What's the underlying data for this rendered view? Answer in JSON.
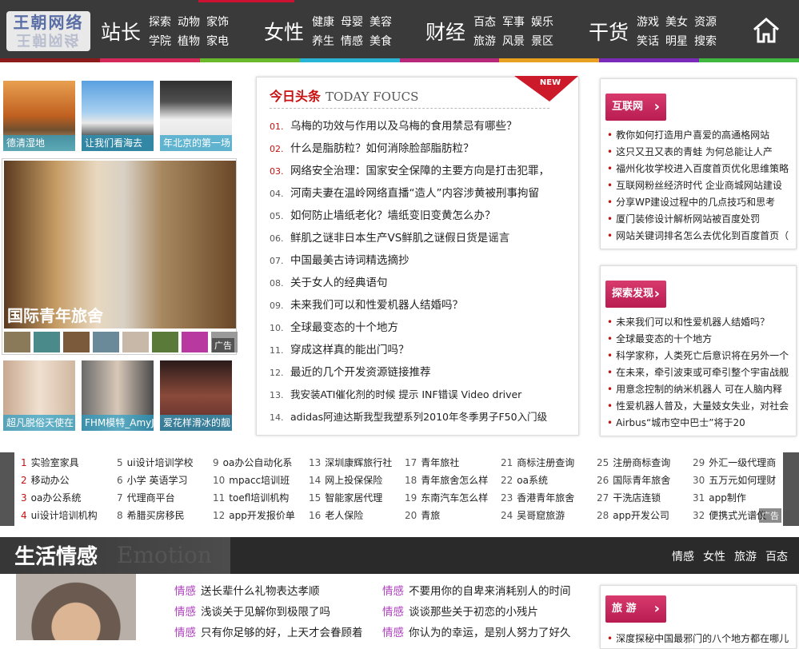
{
  "nav": {
    "logo": "王朝网络",
    "groups": [
      {
        "big": "站长",
        "items": [
          "探索",
          "动物",
          "家饰",
          "学院",
          "植物",
          "家电"
        ]
      },
      {
        "big": "女性",
        "items": [
          "健康",
          "母婴",
          "美容",
          "养生",
          "情感",
          "美食"
        ]
      },
      {
        "big": "财经",
        "items": [
          "百态",
          "军事",
          "娱乐",
          "旅游",
          "风景",
          "景区"
        ]
      },
      {
        "big": "干货",
        "items": [
          "游戏",
          "美女",
          "资源",
          "笑话",
          "明星",
          "搜索"
        ]
      }
    ],
    "home_icon": "home-icon",
    "colors": [
      "#8b1a1a",
      "#d4285a",
      "#6ab82c",
      "#28b4d4",
      "#b8287a",
      "#e8a020",
      "#7a2ab8",
      "#40b840"
    ]
  },
  "left": {
    "thumbs": [
      "德清湿地",
      "让我们看海去",
      "年北京的第一场"
    ],
    "feature_title": "国际青年旅舍",
    "ad": "广告",
    "bottom_thumbs": [
      "超凡脱俗天使在",
      "FHM模特_AmyJac",
      "爱花样滑冰的靓"
    ]
  },
  "center": {
    "title": "今日头条",
    "title_en": "TODAY FOUCS",
    "new": "NEW",
    "items": [
      {
        "n": "01.",
        "t": "乌梅的功效与作用以及乌梅的食用禁忌有哪些？"
      },
      {
        "n": "02.",
        "t": "什么是脂肪粒？如何消除脸部脂肪粒？"
      },
      {
        "n": "03.",
        "t": "网络安全治理：国家安全保障的主要方向是打击犯罪，"
      },
      {
        "n": "04.",
        "t": "河南夫妻在温岭网络直播“造人”内容涉黄被刑事拘留"
      },
      {
        "n": "05.",
        "t": "如何防止墙纸老化？墙纸变旧变黄怎么办？"
      },
      {
        "n": "06.",
        "t": "鲜肌之谜非日本生产VS鲜肌之谜假日货是谣言"
      },
      {
        "n": "07.",
        "t": "中国最美古诗词精选摘抄"
      },
      {
        "n": "08.",
        "t": "关于女人的经典语句"
      },
      {
        "n": "09.",
        "t": "未来我们可以和性爱机器人结婚吗？"
      },
      {
        "n": "10.",
        "t": "全球最变态的十个地方"
      },
      {
        "n": "11.",
        "t": "穿成这样真的能出门吗？"
      },
      {
        "n": "12.",
        "t": "最近的几个开发资源链接推荐"
      },
      {
        "n": "13.",
        "t": "我安装ATI催化剂的时候 提示 INF错误 Video driver"
      },
      {
        "n": "14.",
        "t": "adidas阿迪达斯我型我塑系列2010年冬季男子F50入门级"
      }
    ]
  },
  "right1": {
    "tag": "互联网",
    "items": [
      "教你如何打造用户喜爱的高通格网站",
      "这只又丑又表的青蛙 为何总能让人产",
      "福州化妆学校进入百度首页优化思维策略",
      "互联网粉丝经济时代 企业商城网站建设",
      "分享WP建设过程中的几点技巧和思考",
      "厦门装修设计解析网站被百度处罚",
      "网站关键词排名怎么去优化到百度首页（"
    ]
  },
  "right2": {
    "tag": "探索发现",
    "items": [
      "未来我们可以和性爱机器人结婚吗？",
      "全球最变态的十个地方",
      "科学家称，人类死亡后意识将在另外一个",
      "在未来，牵引波束或可牵引整个宇宙战舰",
      "用意念控制的纳米机器人 可在人脑内释",
      "性爱机器人普及，大量妓女失业，对社会",
      "Airbus“城市空中巴士”将于20"
    ]
  },
  "links": {
    "ad": "广告",
    "items": [
      {
        "n": "1",
        "t": "实验室家具"
      },
      {
        "n": "5",
        "t": "ui设计培训学校"
      },
      {
        "n": "9",
        "t": "oa办公自动化系"
      },
      {
        "n": "13",
        "t": "深圳康辉旅行社"
      },
      {
        "n": "17",
        "t": "青年旅社"
      },
      {
        "n": "21",
        "t": "商标注册查询"
      },
      {
        "n": "25",
        "t": "注册商标查询"
      },
      {
        "n": "29",
        "t": "外汇一级代理商"
      },
      {
        "n": "2",
        "t": "移动办公"
      },
      {
        "n": "6",
        "t": "小学 英语学习"
      },
      {
        "n": "10",
        "t": "mpacc培训班"
      },
      {
        "n": "14",
        "t": "网上投保保险"
      },
      {
        "n": "18",
        "t": "青年旅舍怎么样"
      },
      {
        "n": "22",
        "t": "oa系统"
      },
      {
        "n": "26",
        "t": "国际青年旅舍"
      },
      {
        "n": "30",
        "t": "五万元如何理财"
      },
      {
        "n": "3",
        "t": "oa办公系统"
      },
      {
        "n": "7",
        "t": "代理商平台"
      },
      {
        "n": "11",
        "t": "toefl培训机构"
      },
      {
        "n": "15",
        "t": "智能家居代理"
      },
      {
        "n": "19",
        "t": "东南汽车怎么样"
      },
      {
        "n": "23",
        "t": "香港青年旅舍"
      },
      {
        "n": "27",
        "t": "干洗店连锁"
      },
      {
        "n": "31",
        "t": "app制作"
      },
      {
        "n": "4",
        "t": "ui设计培训机构"
      },
      {
        "n": "8",
        "t": "希腊买房移民"
      },
      {
        "n": "12",
        "t": "app开发报价单"
      },
      {
        "n": "16",
        "t": "老人保险"
      },
      {
        "n": "20",
        "t": "青旅"
      },
      {
        "n": "24",
        "t": "吴哥窟旅游"
      },
      {
        "n": "28",
        "t": "app开发公司"
      },
      {
        "n": "32",
        "t": "便携式光谱仪"
      }
    ]
  },
  "life": {
    "title": "生活情感",
    "title_en": "Emotion",
    "tabs": [
      "情感",
      "女性",
      "旅游",
      "百态"
    ],
    "col1": [
      {
        "c": "情感",
        "t": "送长辈什么礼物表达孝顺"
      },
      {
        "c": "情感",
        "t": "浅谈关于见解你到极限了吗"
      },
      {
        "c": "情感",
        "t": "只有你足够的好，上天才会眷顾着"
      }
    ],
    "col2": [
      {
        "c": "情感",
        "t": "不要用你的自卑来消耗别人的时间"
      },
      {
        "c": "情感",
        "t": "谈谈那些关于初恋的小残片"
      },
      {
        "c": "情感",
        "t": "你认为的幸运，是别人努力了好久"
      }
    ],
    "travel_tag": "旅 游",
    "travel_item": "深度探秘中国最邪门的八个地方都在哪儿"
  }
}
